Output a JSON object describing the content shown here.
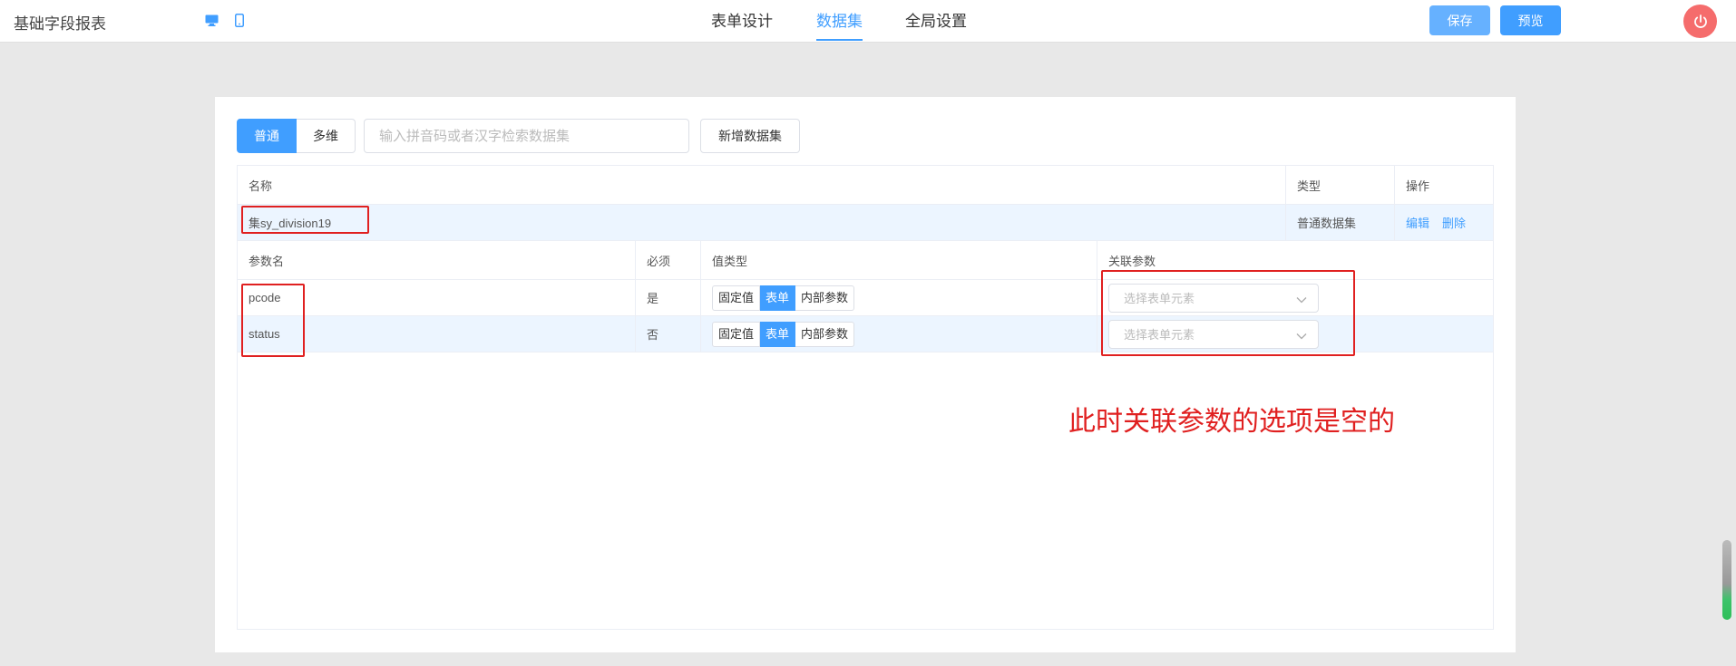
{
  "header": {
    "app_title": "基础字段报表",
    "icons": {
      "desktop": "desktop-icon",
      "mobile": "mobile-icon",
      "power": "power-icon"
    },
    "tabs": [
      {
        "label": "表单设计",
        "active": false
      },
      {
        "label": "数据集",
        "active": true
      },
      {
        "label": "全局设置",
        "active": false
      }
    ],
    "save_label": "保存",
    "preview_label": "预览"
  },
  "toolbar": {
    "segments": [
      {
        "label": "普通",
        "active": true
      },
      {
        "label": "多维",
        "active": false
      }
    ],
    "search_placeholder": "输入拼音码或者汉字检索数据集",
    "add_label": "新增数据集"
  },
  "dataset_table": {
    "columns": {
      "name": "名称",
      "type": "类型",
      "actions": "操作"
    },
    "row": {
      "name": "集sy_division19",
      "type": "普通数据集",
      "edit_label": "编辑",
      "delete_label": "删除"
    }
  },
  "param_table": {
    "columns": {
      "param_name": "参数名",
      "required": "必须",
      "value_type": "值类型",
      "linked_param": "关联参数"
    },
    "value_type_options": [
      "固定值",
      "表单",
      "内部参数"
    ],
    "selected_value_type": "表单",
    "rows": [
      {
        "name": "pcode",
        "required": "是",
        "linked_placeholder": "选择表单元素"
      },
      {
        "name": "status",
        "required": "否",
        "linked_placeholder": "选择表单元素"
      }
    ]
  },
  "annotation": "此时关联参数的选项是空的",
  "colors": {
    "accent": "#409eff",
    "annotation_red": "#e02020",
    "power_red": "#f56c6c"
  }
}
